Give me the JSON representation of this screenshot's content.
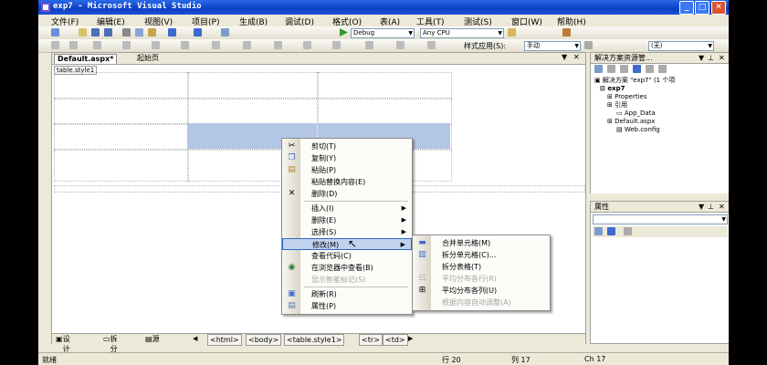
{
  "window": {
    "title": "exp7 - Microsoft Visual Studio"
  },
  "menubar": [
    "文件(F)",
    "编辑(E)",
    "视图(V)",
    "项目(P)",
    "生成(B)",
    "调试(D)",
    "格式(O)",
    "表(A)",
    "工具(T)",
    "测试(S)",
    "窗口(W)",
    "帮助(H)"
  ],
  "toolbar": {
    "config": "Debug",
    "platform": "Any CPU",
    "style_apply_label": "样式应用(S):",
    "style_apply_value": "手动",
    "style_value": "(无)"
  },
  "editor": {
    "tabs": [
      "Default.aspx*",
      "起始页"
    ],
    "table_tag": "table.style1",
    "view_buttons": [
      "设计",
      "拆分",
      "源"
    ],
    "breadcrumbs": [
      "<html>",
      "<body>",
      "<table.style1>",
      "<tr>",
      "<td>"
    ]
  },
  "solution": {
    "title": "解决方案资源管...",
    "items": [
      "解决方案 \"exp7\" (1 个项",
      "exp7",
      "Properties",
      "引用",
      "App_Data",
      "Default.aspx",
      "Web.config"
    ]
  },
  "properties": {
    "title": "属性"
  },
  "context_menu": {
    "items": [
      "剪切(T)",
      "复制(Y)",
      "粘贴(P)",
      "粘贴替换内容(E)",
      "删除(D)",
      "插入(I)",
      "删除(E)",
      "选择(S)",
      "修改(M)",
      "查看代码(C)",
      "在浏览器中查看(B)",
      "显示智能标记(S)",
      "刷新(R)",
      "属性(P)"
    ]
  },
  "submenu": {
    "items": [
      "合并单元格(M)",
      "拆分单元格(C)...",
      "拆分表格(T)",
      "平均分布各行(R)",
      "平均分布各列(U)",
      "根据内容自动调整(A)"
    ]
  },
  "statusbar": {
    "ready": "就绪",
    "row": "行 20",
    "col": "列 17",
    "ch": "Ch 17"
  }
}
